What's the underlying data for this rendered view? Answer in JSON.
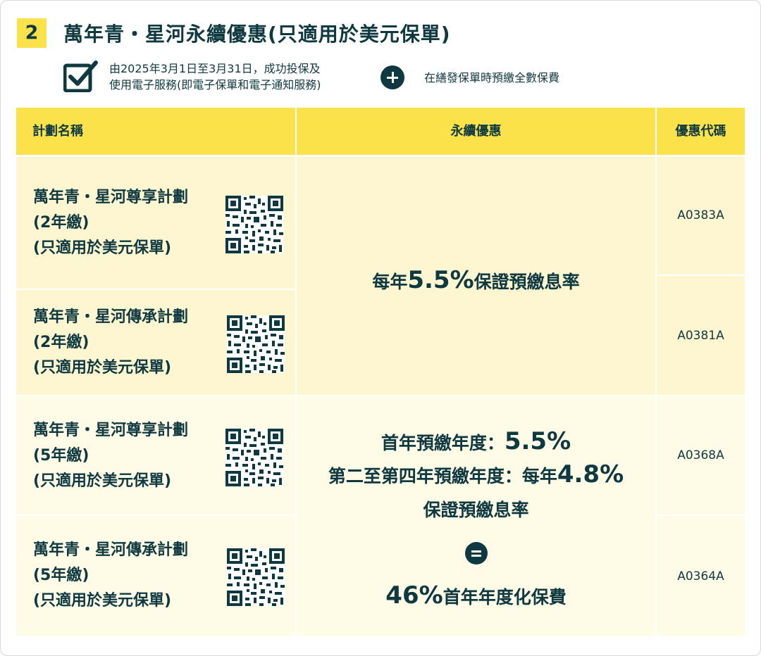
{
  "section": {
    "number": "2",
    "title": "萬年青・星河永續優惠(只適用於美元保單)"
  },
  "conditions": {
    "line1": "由2025年3月1日至3月31日，成功投保及",
    "line2": "使用電子服務(即電子保單和電子通知服務)",
    "plus_icon": "plus-circle-icon",
    "second": "在繕發保單時預繳全數保費"
  },
  "table": {
    "headers": {
      "plan": "計劃名稱",
      "offer": "永續優惠",
      "code": "優惠代碼"
    },
    "rows": [
      {
        "name": "萬年青・星河尊享計劃",
        "term": "(2年繳)",
        "note": "(只適用於美元保單)",
        "code": "A0383A"
      },
      {
        "name": "萬年青・星河傳承計劃",
        "term": "(2年繳)",
        "note": "(只適用於美元保單)",
        "code": "A0381A"
      },
      {
        "name": "萬年青・星河尊享計劃",
        "term": "(5年繳)",
        "note": "(只適用於美元保單)",
        "code": "A0368A"
      },
      {
        "name": "萬年青・星河傳承計劃",
        "term": "(5年繳)",
        "note": "(只適用於美元保單)",
        "code": "A0364A"
      }
    ],
    "offer_2yr": {
      "pre": "每年",
      "rate": "5.5%",
      "post": "保證預繳息率"
    },
    "offer_5yr": {
      "line1_pre": "首年預繳年度：",
      "line1_rate": "5.5%",
      "line2_pre": "第二至第四年預繳年度：每年",
      "line2_rate": "4.8%",
      "line3": "保證預繳息率",
      "equals_icon": "equals-circle-icon",
      "result_rate": "46%",
      "result_text": "首年年度化保費"
    }
  },
  "colors": {
    "accent": "#fbe24a",
    "text": "#0f3940",
    "cell_light": "#fefbe6",
    "cell_yellow": "#fdf6d1"
  }
}
